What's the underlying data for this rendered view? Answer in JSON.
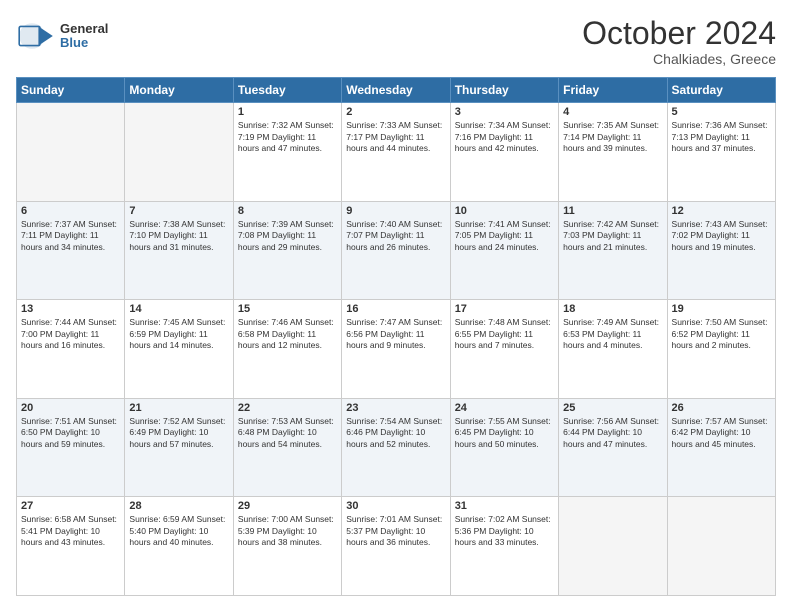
{
  "header": {
    "logo_line1": "General",
    "logo_line2": "Blue",
    "month": "October 2024",
    "location": "Chalkiades, Greece"
  },
  "weekdays": [
    "Sunday",
    "Monday",
    "Tuesday",
    "Wednesday",
    "Thursday",
    "Friday",
    "Saturday"
  ],
  "weeks": [
    [
      {
        "day": "",
        "info": ""
      },
      {
        "day": "",
        "info": ""
      },
      {
        "day": "1",
        "info": "Sunrise: 7:32 AM\nSunset: 7:19 PM\nDaylight: 11 hours and 47 minutes."
      },
      {
        "day": "2",
        "info": "Sunrise: 7:33 AM\nSunset: 7:17 PM\nDaylight: 11 hours and 44 minutes."
      },
      {
        "day": "3",
        "info": "Sunrise: 7:34 AM\nSunset: 7:16 PM\nDaylight: 11 hours and 42 minutes."
      },
      {
        "day": "4",
        "info": "Sunrise: 7:35 AM\nSunset: 7:14 PM\nDaylight: 11 hours and 39 minutes."
      },
      {
        "day": "5",
        "info": "Sunrise: 7:36 AM\nSunset: 7:13 PM\nDaylight: 11 hours and 37 minutes."
      }
    ],
    [
      {
        "day": "6",
        "info": "Sunrise: 7:37 AM\nSunset: 7:11 PM\nDaylight: 11 hours and 34 minutes."
      },
      {
        "day": "7",
        "info": "Sunrise: 7:38 AM\nSunset: 7:10 PM\nDaylight: 11 hours and 31 minutes."
      },
      {
        "day": "8",
        "info": "Sunrise: 7:39 AM\nSunset: 7:08 PM\nDaylight: 11 hours and 29 minutes."
      },
      {
        "day": "9",
        "info": "Sunrise: 7:40 AM\nSunset: 7:07 PM\nDaylight: 11 hours and 26 minutes."
      },
      {
        "day": "10",
        "info": "Sunrise: 7:41 AM\nSunset: 7:05 PM\nDaylight: 11 hours and 24 minutes."
      },
      {
        "day": "11",
        "info": "Sunrise: 7:42 AM\nSunset: 7:03 PM\nDaylight: 11 hours and 21 minutes."
      },
      {
        "day": "12",
        "info": "Sunrise: 7:43 AM\nSunset: 7:02 PM\nDaylight: 11 hours and 19 minutes."
      }
    ],
    [
      {
        "day": "13",
        "info": "Sunrise: 7:44 AM\nSunset: 7:00 PM\nDaylight: 11 hours and 16 minutes."
      },
      {
        "day": "14",
        "info": "Sunrise: 7:45 AM\nSunset: 6:59 PM\nDaylight: 11 hours and 14 minutes."
      },
      {
        "day": "15",
        "info": "Sunrise: 7:46 AM\nSunset: 6:58 PM\nDaylight: 11 hours and 12 minutes."
      },
      {
        "day": "16",
        "info": "Sunrise: 7:47 AM\nSunset: 6:56 PM\nDaylight: 11 hours and 9 minutes."
      },
      {
        "day": "17",
        "info": "Sunrise: 7:48 AM\nSunset: 6:55 PM\nDaylight: 11 hours and 7 minutes."
      },
      {
        "day": "18",
        "info": "Sunrise: 7:49 AM\nSunset: 6:53 PM\nDaylight: 11 hours and 4 minutes."
      },
      {
        "day": "19",
        "info": "Sunrise: 7:50 AM\nSunset: 6:52 PM\nDaylight: 11 hours and 2 minutes."
      }
    ],
    [
      {
        "day": "20",
        "info": "Sunrise: 7:51 AM\nSunset: 6:50 PM\nDaylight: 10 hours and 59 minutes."
      },
      {
        "day": "21",
        "info": "Sunrise: 7:52 AM\nSunset: 6:49 PM\nDaylight: 10 hours and 57 minutes."
      },
      {
        "day": "22",
        "info": "Sunrise: 7:53 AM\nSunset: 6:48 PM\nDaylight: 10 hours and 54 minutes."
      },
      {
        "day": "23",
        "info": "Sunrise: 7:54 AM\nSunset: 6:46 PM\nDaylight: 10 hours and 52 minutes."
      },
      {
        "day": "24",
        "info": "Sunrise: 7:55 AM\nSunset: 6:45 PM\nDaylight: 10 hours and 50 minutes."
      },
      {
        "day": "25",
        "info": "Sunrise: 7:56 AM\nSunset: 6:44 PM\nDaylight: 10 hours and 47 minutes."
      },
      {
        "day": "26",
        "info": "Sunrise: 7:57 AM\nSunset: 6:42 PM\nDaylight: 10 hours and 45 minutes."
      }
    ],
    [
      {
        "day": "27",
        "info": "Sunrise: 6:58 AM\nSunset: 5:41 PM\nDaylight: 10 hours and 43 minutes."
      },
      {
        "day": "28",
        "info": "Sunrise: 6:59 AM\nSunset: 5:40 PM\nDaylight: 10 hours and 40 minutes."
      },
      {
        "day": "29",
        "info": "Sunrise: 7:00 AM\nSunset: 5:39 PM\nDaylight: 10 hours and 38 minutes."
      },
      {
        "day": "30",
        "info": "Sunrise: 7:01 AM\nSunset: 5:37 PM\nDaylight: 10 hours and 36 minutes."
      },
      {
        "day": "31",
        "info": "Sunrise: 7:02 AM\nSunset: 5:36 PM\nDaylight: 10 hours and 33 minutes."
      },
      {
        "day": "",
        "info": ""
      },
      {
        "day": "",
        "info": ""
      }
    ]
  ]
}
